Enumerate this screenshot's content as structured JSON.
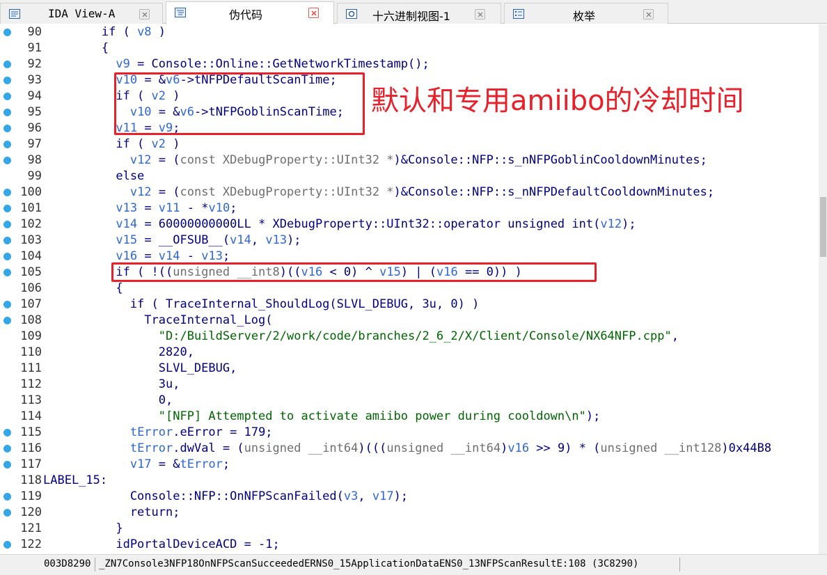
{
  "tabs": [
    {
      "label": "IDA View-A",
      "icon": "disassembly-view-icon",
      "active": false
    },
    {
      "label": "伪代码",
      "icon": "pseudocode-icon",
      "active": true
    },
    {
      "label": "十六进制视图-1",
      "icon": "hex-view-icon",
      "active": false
    },
    {
      "label": "枚举",
      "icon": "enums-icon",
      "active": false
    }
  ],
  "code_lines": [
    {
      "n": "90",
      "bp": true,
      "text": "        if ( v8 )"
    },
    {
      "n": "91",
      "bp": false,
      "text": "        {"
    },
    {
      "n": "92",
      "bp": true,
      "text": "          v9 = Console::Online::GetNetworkTimestamp();"
    },
    {
      "n": "93",
      "bp": true,
      "text": "          v10 = &v6->tNFPDefaultScanTime;"
    },
    {
      "n": "94",
      "bp": true,
      "text": "          if ( v2 )"
    },
    {
      "n": "95",
      "bp": true,
      "text": "            v10 = &v6->tNFPGoblinScanTime;"
    },
    {
      "n": "96",
      "bp": true,
      "text": "          v11 = v9;"
    },
    {
      "n": "97",
      "bp": true,
      "text": "          if ( v2 )"
    },
    {
      "n": "98",
      "bp": true,
      "text": "            v12 = (const XDebugProperty::UInt32 *)&Console::NFP::s_nNFPGoblinCooldownMinutes;"
    },
    {
      "n": "99",
      "bp": false,
      "text": "          else"
    },
    {
      "n": "100",
      "bp": true,
      "text": "            v12 = (const XDebugProperty::UInt32 *)&Console::NFP::s_nNFPDefaultCooldownMinutes;"
    },
    {
      "n": "101",
      "bp": true,
      "text": "          v13 = v11 - *v10;"
    },
    {
      "n": "102",
      "bp": true,
      "text": "          v14 = 60000000000LL * XDebugProperty::UInt32::operator unsigned int(v12);"
    },
    {
      "n": "103",
      "bp": true,
      "text": "          v15 = __OFSUB__(v14, v13);"
    },
    {
      "n": "104",
      "bp": true,
      "text": "          v16 = v14 - v13;"
    },
    {
      "n": "105",
      "bp": true,
      "text": "          if ( !((unsigned __int8)((v16 < 0) ^ v15) | (v16 == 0)) )"
    },
    {
      "n": "106",
      "bp": false,
      "text": "          {"
    },
    {
      "n": "107",
      "bp": true,
      "text": "            if ( TraceInternal_ShouldLog(SLVL_DEBUG, 3u, 0) )"
    },
    {
      "n": "108",
      "bp": true,
      "text": "              TraceInternal_Log("
    },
    {
      "n": "109",
      "bp": false,
      "text": "                \"D:/BuildServer/2/work/code/branches/2_6_2/X/Client/Console/NX64NFP.cpp\","
    },
    {
      "n": "110",
      "bp": false,
      "text": "                2820,"
    },
    {
      "n": "111",
      "bp": false,
      "text": "                SLVL_DEBUG,"
    },
    {
      "n": "112",
      "bp": false,
      "text": "                3u,"
    },
    {
      "n": "113",
      "bp": false,
      "text": "                0,"
    },
    {
      "n": "114",
      "bp": false,
      "text": "                \"[NFP] Attempted to activate amiibo power during cooldown\\n\");"
    },
    {
      "n": "115",
      "bp": true,
      "text": "            tError.eError = 179;"
    },
    {
      "n": "116",
      "bp": true,
      "text": "            tError.dwVal = (unsigned __int64)(((unsigned __int64)v16 >> 9) * (unsigned __int128)0x44B8"
    },
    {
      "n": "117",
      "bp": true,
      "text": "            v17 = &tError;"
    },
    {
      "n": "118",
      "bp": false,
      "text": "LABEL_15:"
    },
    {
      "n": "119",
      "bp": true,
      "text": "            Console::NFP::OnNFPScanFailed(v3, v17);"
    },
    {
      "n": "120",
      "bp": true,
      "text": "            return;"
    },
    {
      "n": "121",
      "bp": false,
      "text": "          }"
    },
    {
      "n": "122",
      "bp": true,
      "text": "          idPortalDeviceACD = -1;"
    }
  ],
  "annotation": "默认和专用amiibo的冷却时间",
  "status": {
    "address": "003D8290",
    "function": "_ZN7Console3NFP18OnNFPScanSucceededERNS0_15ApplicationDataENS0_13NFPScanResultE:108 (3C8290)"
  },
  "colors": {
    "highlight": "#e8202a",
    "breakpoint": "#36a7e6",
    "variable": "#2f66d6",
    "keyword": "#000080",
    "string": "#006400",
    "cast": "#6e6e6e"
  }
}
